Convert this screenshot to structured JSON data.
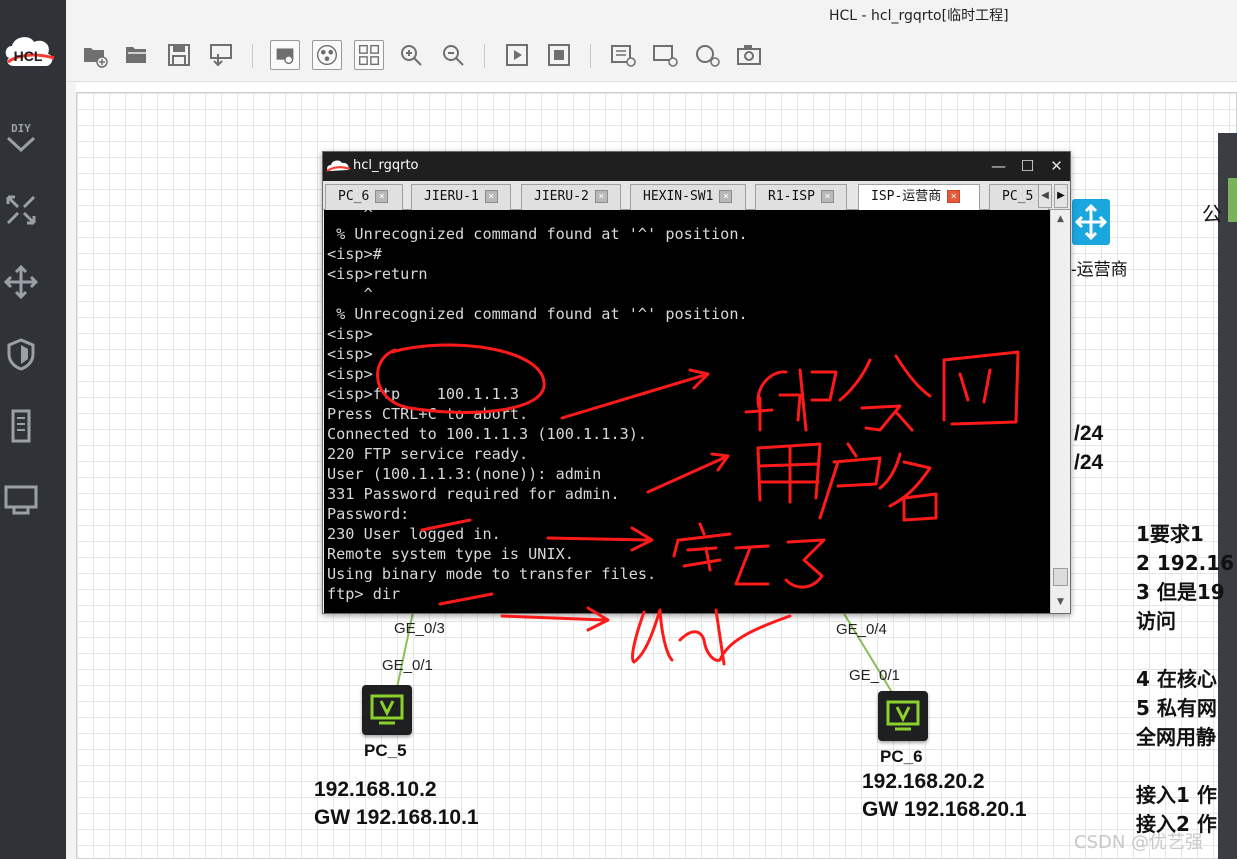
{
  "app": {
    "title": "HCL - hcl_rgqrto[临时工程]",
    "logo_text": "HCL"
  },
  "sidebar": {
    "logo_text": "HCL",
    "items": [
      {
        "name": "diy-icon",
        "label": "DIY"
      },
      {
        "name": "router-icon"
      },
      {
        "name": "switch-icon"
      },
      {
        "name": "firewall-icon"
      },
      {
        "name": "server-icon"
      },
      {
        "name": "terminal-icon"
      }
    ]
  },
  "toolbar": {
    "buttons": [
      "new-project-icon",
      "open-project-icon",
      "save-icon",
      "export-icon",
      "device-display-icon",
      "topology-icon",
      "layout-grid-icon",
      "zoom-in-icon",
      "zoom-out-icon",
      "start-all-icon",
      "stop-all-icon",
      "add-text-icon",
      "add-rectangle-icon",
      "add-ellipse-icon",
      "screenshot-icon"
    ]
  },
  "terminal_window": {
    "title": "hcl_rgqrto",
    "controls": {
      "minimize": "—",
      "maximize": "☐",
      "close": "✕"
    },
    "tabs": [
      {
        "label": "PC_6",
        "active": false
      },
      {
        "label": "JIERU-1",
        "active": false
      },
      {
        "label": "JIERU-2",
        "active": false
      },
      {
        "label": "HEXIN-SW1",
        "active": false
      },
      {
        "label": "R1-ISP",
        "active": false
      },
      {
        "label": "ISP-运营商",
        "active": true
      },
      {
        "label": "PC_5",
        "active": false
      }
    ],
    "lines": [
      "    ^",
      " % Unrecognized command found at '^' position.",
      "<isp>#",
      "<isp>return",
      "    ^",
      " % Unrecognized command found at '^' position.",
      "<isp>",
      "<isp>",
      "<isp>",
      "<isp>ftp    100.1.1.3",
      "Press CTRL+C to abort.",
      "Connected to 100.1.1.3 (100.1.1.3).",
      "220 FTP service ready.",
      "User (100.1.1.3:(none)): admin",
      "331 Password required for admin.",
      "Password:",
      "230 User logged in.",
      "Remote system type is UNIX.",
      "Using binary mode to transfer files.",
      "ftp> dir"
    ]
  },
  "canvas": {
    "isp_device_label": "运营商",
    "isp_prefix": "-",
    "corner_char": "公",
    "subnet_1": "/24",
    "subnet_2": "/24",
    "notes": [
      "1要求1",
      "2 192.16",
      "3 但是19",
      "访问",
      "4 在核心",
      "5 私有网",
      "全网用静",
      "接入1 作",
      "接入2 作"
    ],
    "ports": {
      "pc5_upper": "GE_0/3",
      "pc5_lower": "GE_0/1",
      "pc6_upper": "GE_0/4",
      "pc6_lower": "GE_0/1"
    },
    "pc5": {
      "name": "PC_5",
      "ip": "192.168.10.2",
      "gw": "GW  192.168.10.1"
    },
    "pc6": {
      "name": "PC_6",
      "ip": "192.168.20.2",
      "gw": "GW  192.168.20.1"
    }
  },
  "annotations": {
    "color": "#ff1a1a",
    "handwritten": [
      "ftp公网",
      "用户名",
      "密码",
      "dir"
    ]
  },
  "watermark": "CSDN @优艺强"
}
